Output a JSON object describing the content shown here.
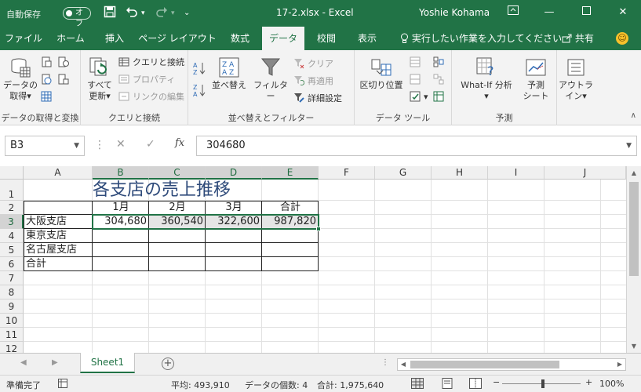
{
  "titlebar": {
    "autosave_label": "自動保存",
    "autosave_state": "オフ",
    "document": "17-2.xlsx  -  Excel",
    "user": "Yoshie Kohama"
  },
  "tabs": [
    "ファイル",
    "ホーム",
    "挿入",
    "ページ レイアウト",
    "数式",
    "データ",
    "校閲",
    "表示"
  ],
  "active_tab": "データ",
  "tell_me": "実行したい作業を入力してください",
  "share": "共有",
  "ribbon": {
    "get_data": {
      "label": "データの取得と変換",
      "button1": "データの",
      "button2": "取得",
      "dropdown": "▾"
    },
    "queries": {
      "label": "クエリと接続",
      "refresh1": "すべて",
      "refresh2": "更新",
      "queries_connections": "クエリと接続",
      "properties": "プロパティ",
      "edit_links": "リンクの編集"
    },
    "sort_filter": {
      "label": "並べ替えとフィルター",
      "sort": "並べ替え",
      "filter": "フィルター",
      "clear": "クリア",
      "reapply": "再適用",
      "advanced": "詳細設定"
    },
    "data_tools": {
      "label": "データ ツール",
      "text_to_columns": "区切り位置"
    },
    "forecast": {
      "label": "予測",
      "whatif1": "What-If 分析",
      "forecast1": "予測",
      "forecast2": "シート"
    },
    "outline": {
      "outline1": "アウトラ",
      "outline2": "イン"
    }
  },
  "formula_bar": {
    "name_box": "B3",
    "fx": "fx",
    "value": "304680"
  },
  "columns": [
    "A",
    "B",
    "C",
    "D",
    "E",
    "F",
    "G",
    "H",
    "I",
    "J"
  ],
  "rows": [
    "1",
    "2",
    "3",
    "4",
    "5",
    "6",
    "7",
    "8",
    "9",
    "10",
    "11",
    "12"
  ],
  "sheet": {
    "title": "各支店の売上推移",
    "headers": [
      "1月",
      "2月",
      "3月",
      "合計"
    ],
    "row_labels": [
      "大阪支店",
      "東京支店",
      "名古屋支店",
      "合計"
    ],
    "osaka_values": [
      "304,680",
      "360,540",
      "322,600",
      "987,820"
    ]
  },
  "sheet_tab": "Sheet1",
  "status": {
    "ready": "準備完了",
    "average": "平均: 493,910",
    "count": "データの個数: 4",
    "sum": "合計: 1,975,640",
    "zoom": "100%"
  },
  "colors": {
    "accent": "#217346",
    "title_text": "#2e4a7a"
  }
}
